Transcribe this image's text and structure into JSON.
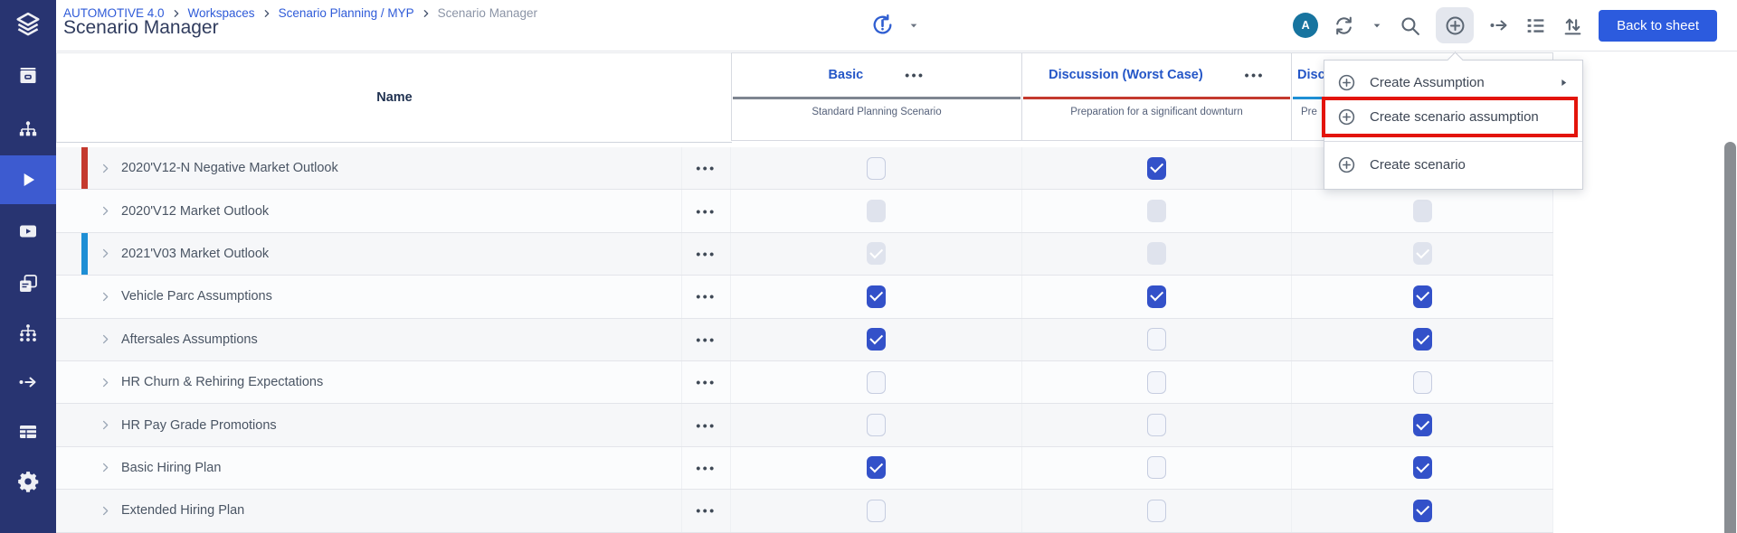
{
  "page_title": "Scenario Manager",
  "breadcrumb": {
    "items": [
      {
        "label": "AUTOMOTIVE 4.0",
        "current": false
      },
      {
        "label": "Workspaces",
        "current": false
      },
      {
        "label": "Scenario Planning / MYP",
        "current": false
      },
      {
        "label": "Scenario Manager",
        "current": true
      }
    ]
  },
  "sidebar": {
    "items": [
      {
        "icon": "layers-logo",
        "active": false
      },
      {
        "icon": "archive",
        "active": false
      },
      {
        "icon": "org-chart",
        "active": false
      },
      {
        "icon": "play",
        "active": true
      },
      {
        "icon": "video-play",
        "active": false
      },
      {
        "icon": "documents",
        "active": false
      },
      {
        "icon": "node-tree",
        "active": false
      },
      {
        "icon": "jump-arrow",
        "active": false
      },
      {
        "icon": "table-grid",
        "active": false
      },
      {
        "icon": "settings-gear",
        "active": false
      }
    ]
  },
  "topbar": {
    "avatar_initial": "A",
    "back_button_label": "Back to sheet",
    "icons": [
      "refresh",
      "chevron-down",
      "search",
      "add-circle",
      "jump-arrow",
      "details-list",
      "sort-arrows"
    ],
    "history_icon": "history-alert",
    "more_dots": "•••"
  },
  "create_menu": {
    "items": [
      {
        "label": "Create Assumption",
        "has_submenu": true,
        "highlighted": false
      },
      {
        "label": "Create scenario assumption",
        "has_submenu": false,
        "highlighted": true
      },
      {
        "label": "Create scenario",
        "has_submenu": false,
        "highlighted": false
      }
    ]
  },
  "table": {
    "name_header": "Name",
    "scenario_columns": [
      {
        "title": "Basic",
        "subtitle": "Standard Planning Scenario",
        "bar_color": "#7E8590",
        "truncated": false
      },
      {
        "title": "Discussion (Worst Case)",
        "subtitle": "Preparation for a significant downturn",
        "bar_color": "#C4392E",
        "truncated": false
      },
      {
        "title": "Disc",
        "subtitle": "Pre",
        "bar_color": "#1E8FD5",
        "truncated": true
      }
    ],
    "rows": [
      {
        "name": "2020'V12-N Negative Market Outlook",
        "indicator": "#C4392E",
        "checks": [
          "unchecked",
          "checked",
          "hidden"
        ]
      },
      {
        "name": "2020'V12 Market Outlook",
        "indicator": null,
        "checks": [
          "disabled",
          "disabled",
          "disabled"
        ]
      },
      {
        "name": "2021'V03 Market Outlook",
        "indicator": "#1E8FD5",
        "checks": [
          "disabled-checked",
          "disabled",
          "disabled-checked"
        ]
      },
      {
        "name": "Vehicle Parc Assumptions",
        "indicator": null,
        "checks": [
          "checked",
          "checked",
          "checked"
        ]
      },
      {
        "name": "Aftersales Assumptions",
        "indicator": null,
        "checks": [
          "checked",
          "unchecked",
          "checked"
        ]
      },
      {
        "name": "HR Churn & Rehiring Expectations",
        "indicator": null,
        "checks": [
          "unchecked",
          "unchecked",
          "unchecked"
        ]
      },
      {
        "name": "HR Pay Grade Promotions",
        "indicator": null,
        "checks": [
          "unchecked",
          "unchecked",
          "checked"
        ]
      },
      {
        "name": "Basic Hiring Plan",
        "indicator": null,
        "checks": [
          "checked",
          "unchecked",
          "checked"
        ]
      },
      {
        "name": "Extended Hiring Plan",
        "indicator": null,
        "checks": [
          "unchecked",
          "unchecked",
          "checked"
        ]
      }
    ]
  },
  "colors": {
    "sidebar_bg": "#283471",
    "sidebar_active": "#3D5BD0",
    "link_blue": "#2F5BD8",
    "header_blue": "#2456C7",
    "checkbox_blue": "#3351C9",
    "back_button_blue": "#2C5BDE",
    "avatar_teal": "#17749F",
    "annotation_red": "#E3140B",
    "scenario_bar_gray": "#7E8590",
    "scenario_bar_red": "#C4392E",
    "scenario_bar_blue": "#1E8FD5"
  }
}
